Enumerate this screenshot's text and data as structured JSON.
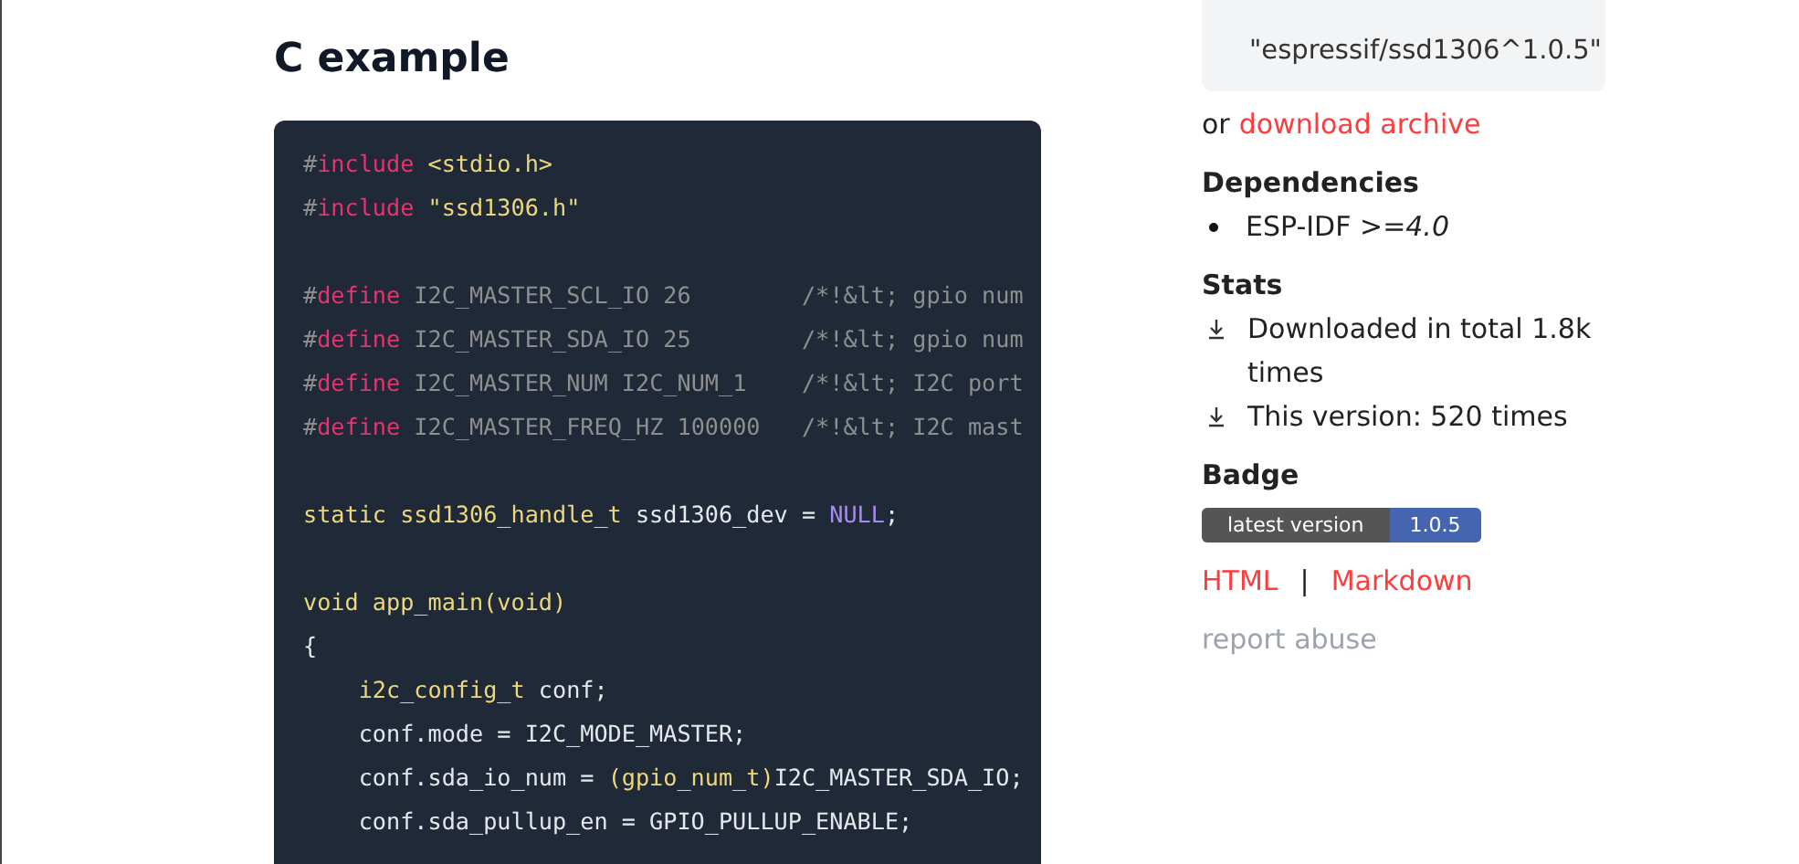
{
  "heading": "C example",
  "code_lines": [
    {
      "tokens": [
        {
          "kind": "hash",
          "t": "#"
        },
        {
          "kind": "keyword",
          "t": "include "
        },
        {
          "kind": "string",
          "t": "<stdio.h>"
        }
      ]
    },
    {
      "tokens": [
        {
          "kind": "hash",
          "t": "#"
        },
        {
          "kind": "keyword",
          "t": "include "
        },
        {
          "kind": "string",
          "t": "\"ssd1306.h\""
        }
      ]
    },
    {
      "gap_before": true,
      "tokens": [
        {
          "kind": "hash",
          "t": "#"
        },
        {
          "kind": "keyword",
          "t": "define"
        },
        {
          "kind": "comment",
          "t": " I2C_MASTER_SCL_IO 26        /*!&lt; gpio num"
        }
      ]
    },
    {
      "tokens": [
        {
          "kind": "hash",
          "t": "#"
        },
        {
          "kind": "keyword",
          "t": "define"
        },
        {
          "kind": "comment",
          "t": " I2C_MASTER_SDA_IO 25        /*!&lt; gpio num"
        }
      ]
    },
    {
      "tokens": [
        {
          "kind": "hash",
          "t": "#"
        },
        {
          "kind": "keyword",
          "t": "define"
        },
        {
          "kind": "comment",
          "t": " I2C_MASTER_NUM I2C_NUM_1    /*!&lt; I2C port"
        }
      ]
    },
    {
      "tokens": [
        {
          "kind": "hash",
          "t": "#"
        },
        {
          "kind": "keyword",
          "t": "define"
        },
        {
          "kind": "comment",
          "t": " I2C_MASTER_FREQ_HZ 100000   /*!&lt; I2C mast"
        }
      ]
    },
    {
      "gap_before": true,
      "tokens": [
        {
          "kind": "type",
          "t": "static ssd1306_handle_t"
        },
        {
          "kind": "plain",
          "t": " ssd1306_dev = "
        },
        {
          "kind": "constant",
          "t": "NULL"
        },
        {
          "kind": "plain",
          "t": ";"
        }
      ]
    },
    {
      "gap_before": true,
      "tokens": [
        {
          "kind": "type",
          "t": "void app_main(void)"
        }
      ]
    },
    {
      "tokens": [
        {
          "kind": "plain",
          "t": "{"
        }
      ]
    },
    {
      "indented": true,
      "tokens": [
        {
          "kind": "type",
          "t": "i2c_config_t"
        },
        {
          "kind": "plain",
          "t": " conf;"
        }
      ]
    },
    {
      "indented": true,
      "tokens": [
        {
          "kind": "plain",
          "t": "conf.mode = I2C_MODE_MASTER;"
        }
      ]
    },
    {
      "indented": true,
      "tokens": [
        {
          "kind": "plain",
          "t": "conf.sda_io_num = "
        },
        {
          "kind": "type",
          "t": "(gpio_num_t)"
        },
        {
          "kind": "plain",
          "t": "I2C_MASTER_SDA_IO;"
        }
      ]
    },
    {
      "indented": true,
      "tokens": [
        {
          "kind": "plain",
          "t": "conf.sda_pullup_en = GPIO_PULLUP_ENABLE;"
        }
      ]
    }
  ],
  "sidebar": {
    "install_command": "\"espressif/ssd1306^1.0.5\"",
    "download_prefix": "or",
    "download_link": "download archive",
    "dependencies_title": "Dependencies",
    "dependencies": [
      "ESP-IDF *>=4.0*"
    ],
    "stats_title": "Stats",
    "stats": [
      "Downloaded in total 1.8k times",
      "This version: 520 times"
    ],
    "badge_title": "Badge",
    "badge": {
      "label": "latest version",
      "value": "1.0.5"
    },
    "badge_links": [
      "HTML",
      "Markdown"
    ],
    "badge_separator": "|",
    "report_link": "report abuse"
  }
}
